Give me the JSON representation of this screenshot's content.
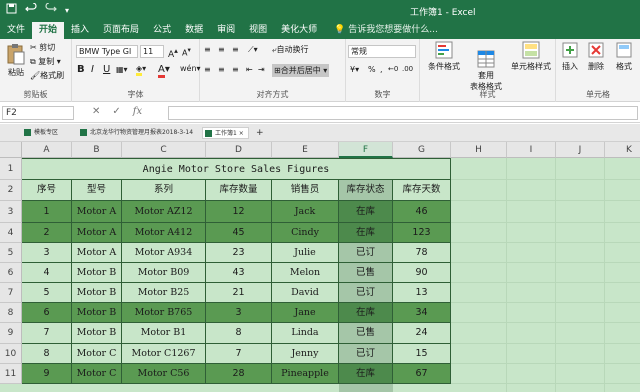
{
  "window": {
    "title": "工作簿1 - Excel",
    "quick_access": [
      "save-icon",
      "undo-icon",
      "redo-icon",
      "customize-icon"
    ]
  },
  "ribbon_tabs": [
    "文件",
    "开始",
    "插入",
    "页面布局",
    "公式",
    "数据",
    "审阅",
    "视图",
    "美化大师"
  ],
  "tell_me": "告诉我您想要做什么...",
  "ribbon": {
    "clipboard": {
      "paste": "粘贴",
      "cut": "剪切",
      "copy": "复制",
      "format_painter": "格式刷",
      "label": "剪贴板"
    },
    "font": {
      "name": "BMW Type Gl",
      "size": "11",
      "label": "字体"
    },
    "alignment": {
      "wrap": "自动换行",
      "merge": "合并后居中",
      "label": "对齐方式"
    },
    "number": {
      "format": "常规",
      "label": "数字"
    },
    "styles": {
      "conditional": "条件格式",
      "table": "套用\n表格格式",
      "cell_styles": "单元格样式",
      "label": "样式"
    },
    "cells": {
      "insert": "插入",
      "delete": "删除",
      "format": "格式",
      "label": "单元格"
    }
  },
  "formula_bar": {
    "name_box": "F2",
    "fx": "fx"
  },
  "workbook_tabs": [
    {
      "label": "模板专区"
    },
    {
      "label": "北京龙华行物资管理月报表2018-3-14"
    },
    {
      "label": "工作簿1"
    }
  ],
  "sheet": {
    "columns": [
      "A",
      "B",
      "C",
      "D",
      "E",
      "F",
      "G",
      "H",
      "I",
      "J",
      "K"
    ],
    "rows": [
      "1",
      "2",
      "3",
      "4",
      "5",
      "6",
      "7",
      "8",
      "9",
      "10",
      "11"
    ],
    "title": "Angie Motor Store Sales Figures",
    "headers": [
      "序号",
      "型号",
      "系列",
      "库存数量",
      "销售员",
      "库存状态",
      "库存天数"
    ],
    "data": [
      [
        "1",
        "Motor A",
        "Motor AZ12",
        "12",
        "Jack",
        "在库",
        "46"
      ],
      [
        "2",
        "Motor A",
        "Motor A412",
        "45",
        "Cindy",
        "在库",
        "123"
      ],
      [
        "3",
        "Motor A",
        "Motor A934",
        "23",
        "Julie",
        "已订",
        "78"
      ],
      [
        "4",
        "Motor B",
        "Motor B09",
        "43",
        "Melon",
        "已售",
        "90"
      ],
      [
        "5",
        "Motor B",
        "Motor B25",
        "21",
        "David",
        "已订",
        "13"
      ],
      [
        "6",
        "Motor B",
        "Motor B765",
        "3",
        "Jane",
        "在库",
        "34"
      ],
      [
        "7",
        "Motor B",
        "Motor B1",
        "8",
        "Linda",
        "已售",
        "24"
      ],
      [
        "8",
        "Motor C",
        "Motor C1267",
        "7",
        "Jenny",
        "已订",
        "15"
      ],
      [
        "9",
        "Motor C",
        "Motor C56",
        "28",
        "Pineapple",
        "在库",
        "67"
      ]
    ],
    "selected_column": "F",
    "colors": {
      "highlight_row": "#5a9a52",
      "sheet_bg": "#c8e6c9",
      "accent": "#217346"
    }
  }
}
